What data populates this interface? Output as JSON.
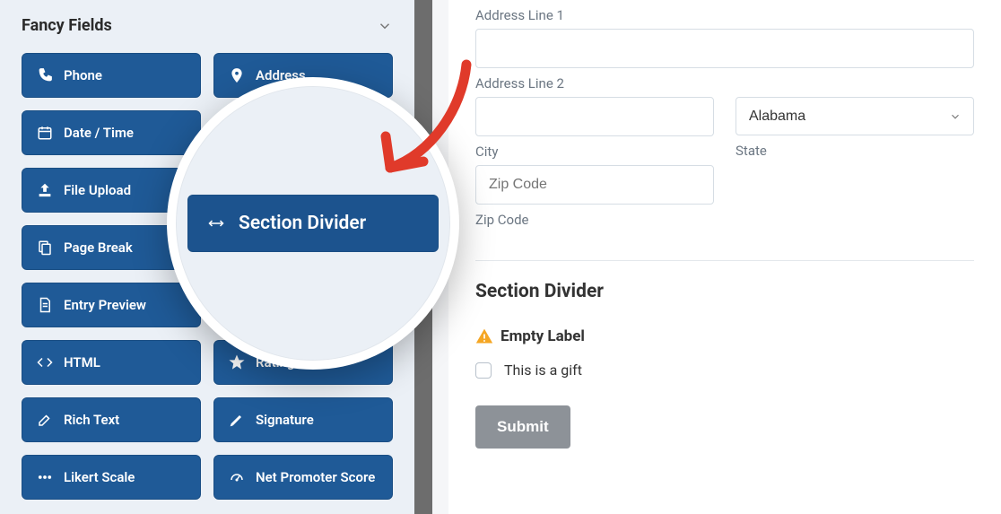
{
  "sidebar": {
    "section_title": "Fancy Fields",
    "items": [
      {
        "label": "Phone",
        "icon": "phone-icon"
      },
      {
        "label": "Address",
        "icon": "map-pin-icon"
      },
      {
        "label": "Date / Time",
        "icon": "calendar-icon"
      },
      {
        "label": "",
        "icon": ""
      },
      {
        "label": "File Upload",
        "icon": "upload-icon"
      },
      {
        "label": "",
        "icon": ""
      },
      {
        "label": "Page Break",
        "icon": "pages-icon"
      },
      {
        "label": "",
        "icon": ""
      },
      {
        "label": "Entry Preview",
        "icon": "document-icon"
      },
      {
        "label": "",
        "icon": ""
      },
      {
        "label": "HTML",
        "icon": "code-icon"
      },
      {
        "label": "Rating",
        "icon": "star-icon"
      },
      {
        "label": "Rich Text",
        "icon": "edit-icon"
      },
      {
        "label": "Signature",
        "icon": "pencil-icon"
      },
      {
        "label": "Likert Scale",
        "icon": "dots-icon"
      },
      {
        "label": "Net Promoter Score",
        "icon": "gauge-icon"
      }
    ]
  },
  "magnified": {
    "label": "Section Divider",
    "icon": "divider-icon"
  },
  "preview": {
    "address1_label": "Address Line 1",
    "address2_label": "Address Line 2",
    "city_label": "City",
    "state_label": "State",
    "state_value": "Alabama",
    "zip_placeholder": "Zip Code",
    "zip_label": "Zip Code",
    "section_title": "Section Divider",
    "warning_label": "Empty Label",
    "checkbox_label": "This is a gift",
    "submit_label": "Submit"
  }
}
